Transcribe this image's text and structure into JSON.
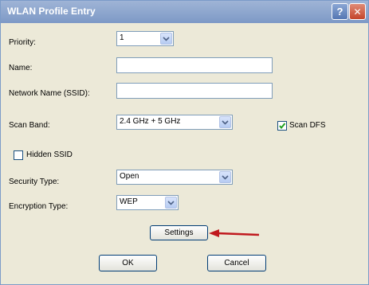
{
  "window": {
    "title": "WLAN Profile Entry"
  },
  "titlebar": {
    "help_label": "?",
    "close_label": "✕"
  },
  "fields": {
    "priority_label": "Priority:",
    "priority_value": "1",
    "name_label": "Name:",
    "name_value": "",
    "ssid_label": "Network Name (SSID):",
    "ssid_value": "",
    "scan_band_label": "Scan Band:",
    "scan_band_value": "2.4 GHz + 5 GHz",
    "scan_dfs_label": "Scan DFS",
    "scan_dfs_checked": true,
    "hidden_ssid_label": "Hidden SSID",
    "hidden_ssid_checked": false,
    "security_type_label": "Security Type:",
    "security_type_value": "Open",
    "encryption_type_label": "Encryption Type:",
    "encryption_type_value": "WEP"
  },
  "buttons": {
    "settings_label": "Settings",
    "ok_label": "OK",
    "cancel_label": "Cancel"
  },
  "colors": {
    "titlebar": "#7d99c6",
    "close": "#c4452b",
    "annotation_arrow": "#c0191e"
  }
}
